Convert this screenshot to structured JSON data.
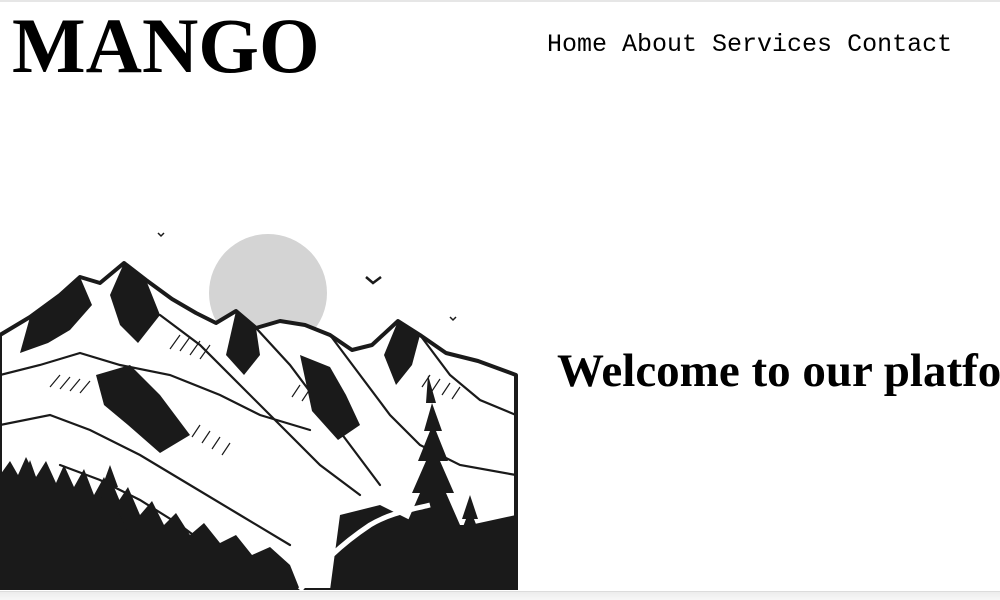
{
  "header": {
    "brand": "MANGO",
    "nav": [
      {
        "label": "Home"
      },
      {
        "label": "About"
      },
      {
        "label": "Services"
      },
      {
        "label": "Contact"
      }
    ]
  },
  "hero": {
    "heading": "Welcome to our platfo",
    "illustration": "mountain-landscape-illustration"
  },
  "colors": {
    "text": "#000000",
    "background": "#ffffff",
    "sun": "#d4d4d4",
    "ink": "#1a1a1a"
  }
}
